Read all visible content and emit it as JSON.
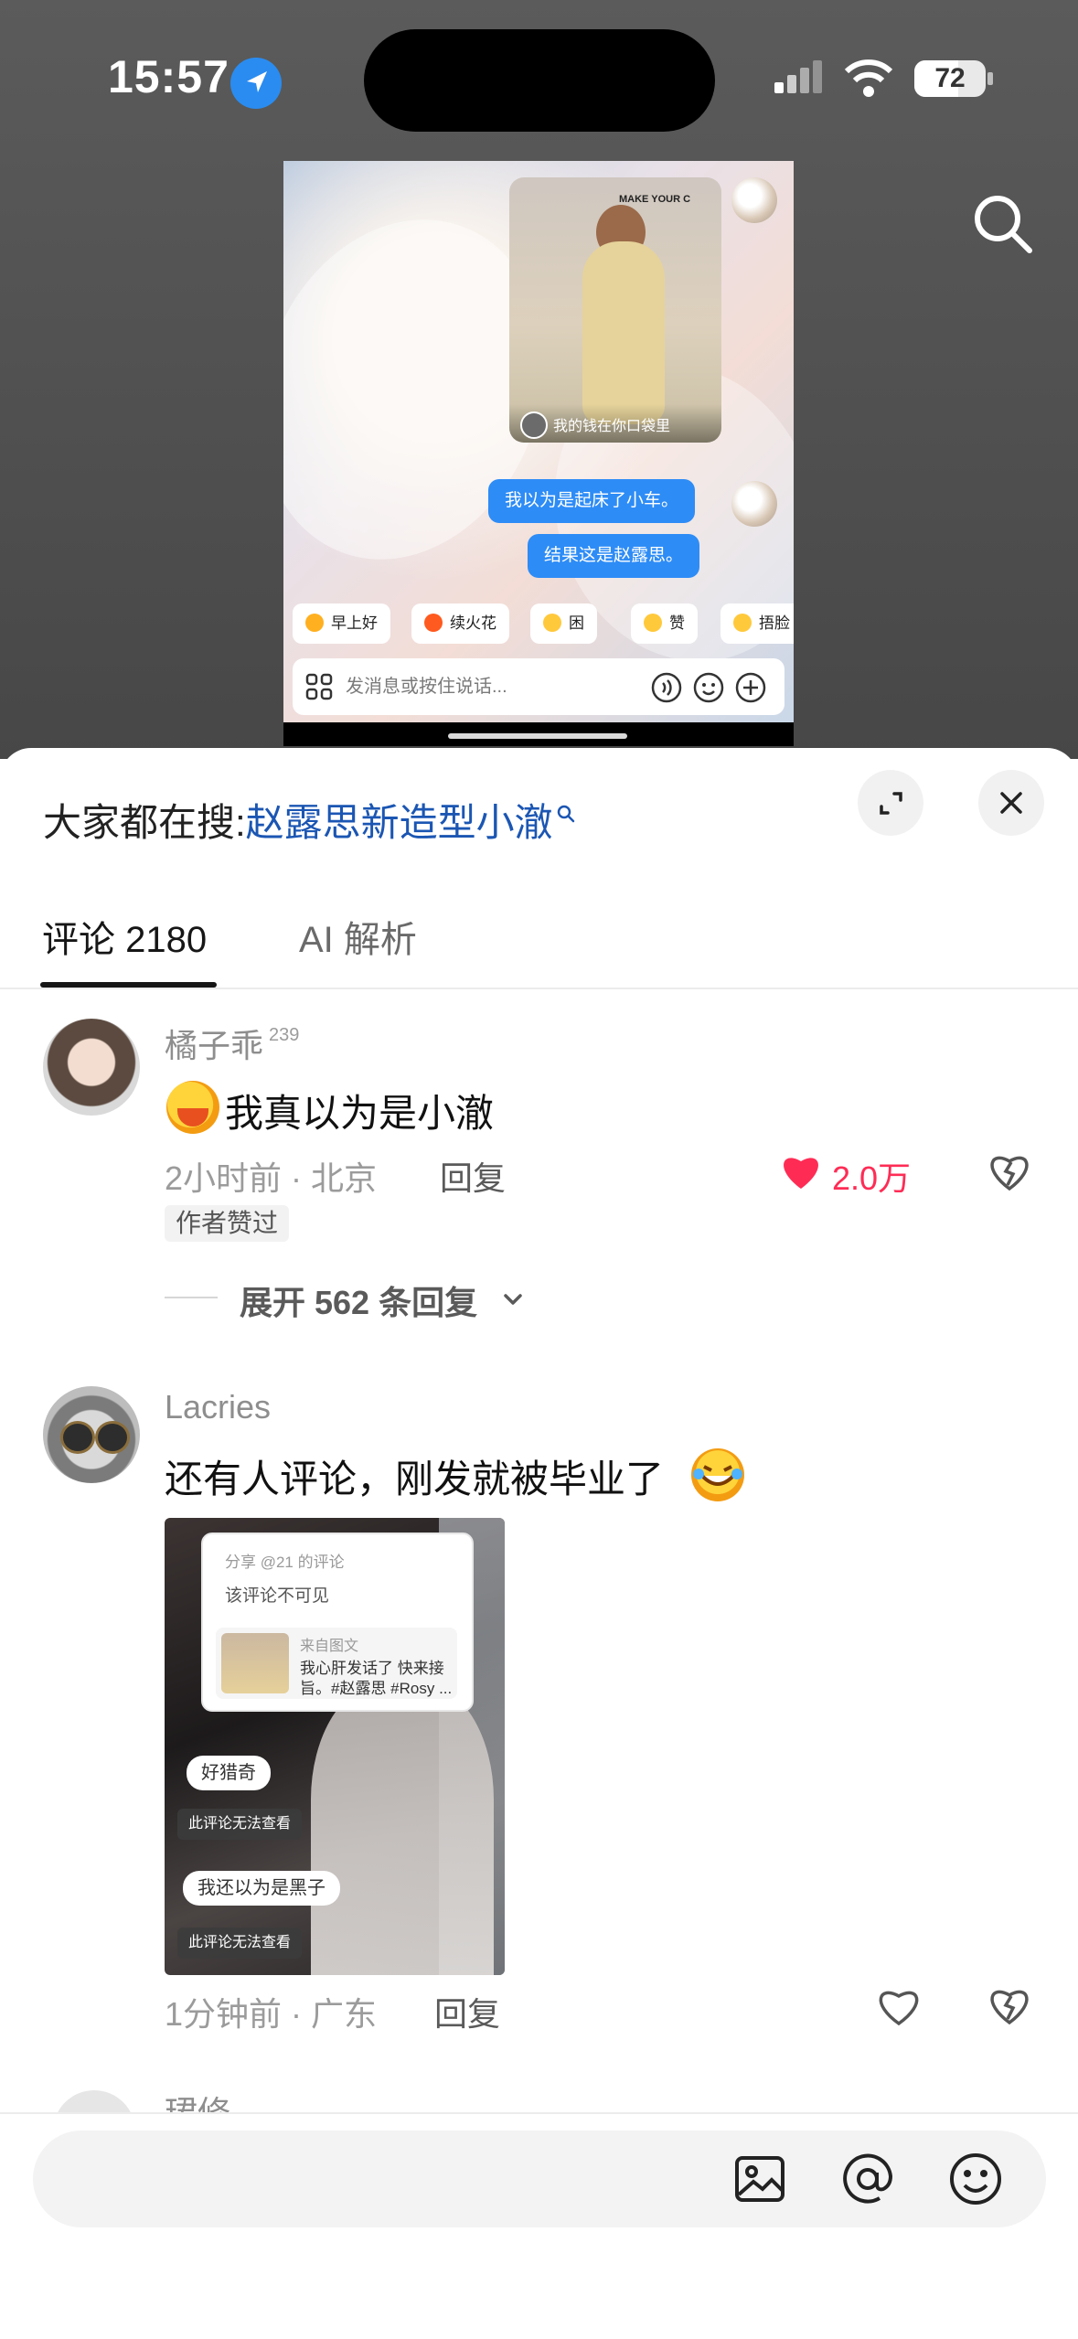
{
  "status_bar": {
    "time": "15:57",
    "battery": "72"
  },
  "shared_card": {
    "photo_caption": "我的钱在你口袋里",
    "photo_brand": "MAKE YOUR C",
    "message_1": "我以为是起床了小车。",
    "message_2": "结果这是赵露思。",
    "quick_chips": [
      {
        "label": "早上好",
        "color": "#ffb020"
      },
      {
        "label": "续火花",
        "color": "#ff5a1f"
      },
      {
        "label": "困",
        "color": "#ffc93c"
      },
      {
        "label": "赞",
        "color": "#ffc93c"
      },
      {
        "label": "捂脸",
        "color": "#ffc93c"
      }
    ],
    "input_placeholder": "发消息或按住说话..."
  },
  "sheet": {
    "everyone_search_prefix": "大家都在搜:",
    "trending_query": "赵露思新造型小澈",
    "tabs": [
      {
        "label": "评论 2180"
      },
      {
        "label": "AI 解析"
      }
    ]
  },
  "comments": [
    {
      "user": "橘子乖",
      "level": "239",
      "text": "我真以为是小澈",
      "meta": "2小时前 · 北京",
      "reply_label": "回复",
      "likes": "2.0万",
      "author_liked": "作者赞过",
      "expand_replies": "展开 562 条回复"
    },
    {
      "user": "Lacries",
      "text": "还有人评论，刚发就被毕业了",
      "meta": "1分钟前 · 广东",
      "reply_label": "回复",
      "image": {
        "share_title": "分享 @21 的评论",
        "hidden_note": "该评论不可见",
        "from_label": "来自图文",
        "quote_line1": "我心肝发话了 快来接",
        "quote_line2": "旨。#赵露思 #Rosy ...",
        "tag_curious": "好猎奇",
        "cannot_view": "此评论无法查看",
        "tag_black": "我还以为是黑子",
        "cannot_view_2": "此评论无法查看"
      }
    },
    {
      "user": "珺修"
    }
  ],
  "composer": {
    "placeholder": ""
  },
  "colors": {
    "accent_red": "#fe2c55",
    "link_blue": "#1b56b3",
    "chat_blue": "#2e8cf6"
  }
}
